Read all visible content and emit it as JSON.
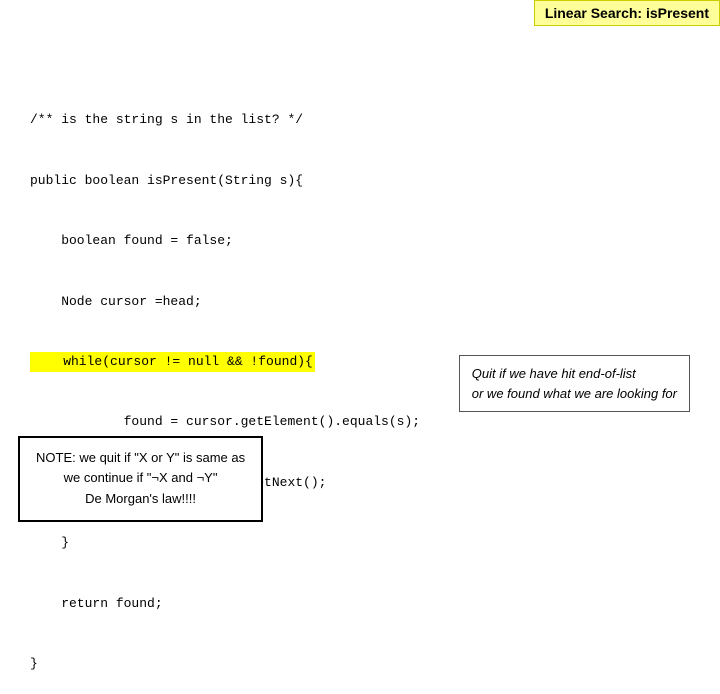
{
  "title": {
    "label": "Linear Search: isPresent"
  },
  "code": {
    "line1": "/** is the string s in the list? */",
    "line2": "public boolean isPresent(String s){",
    "line3": "    boolean found = false;",
    "line4": "    Node cursor =head;",
    "line5_highlighted": "    while(cursor != null && !found){",
    "line6": "            found = cursor.getElement().equals(s);",
    "line7": "            cursor = cursor.getNext();",
    "line8": "    }",
    "line9": "    return found;",
    "line10": "}"
  },
  "tooltip": {
    "line1": "Quit if we have hit end-of-list",
    "line2": "or we found what we are looking for"
  },
  "note": {
    "line1": "NOTE: we quit if \"X or Y\" is same as",
    "line2": "we continue if \"¬X and ¬Y\"",
    "line3": "De Morgan's law!!!!"
  }
}
